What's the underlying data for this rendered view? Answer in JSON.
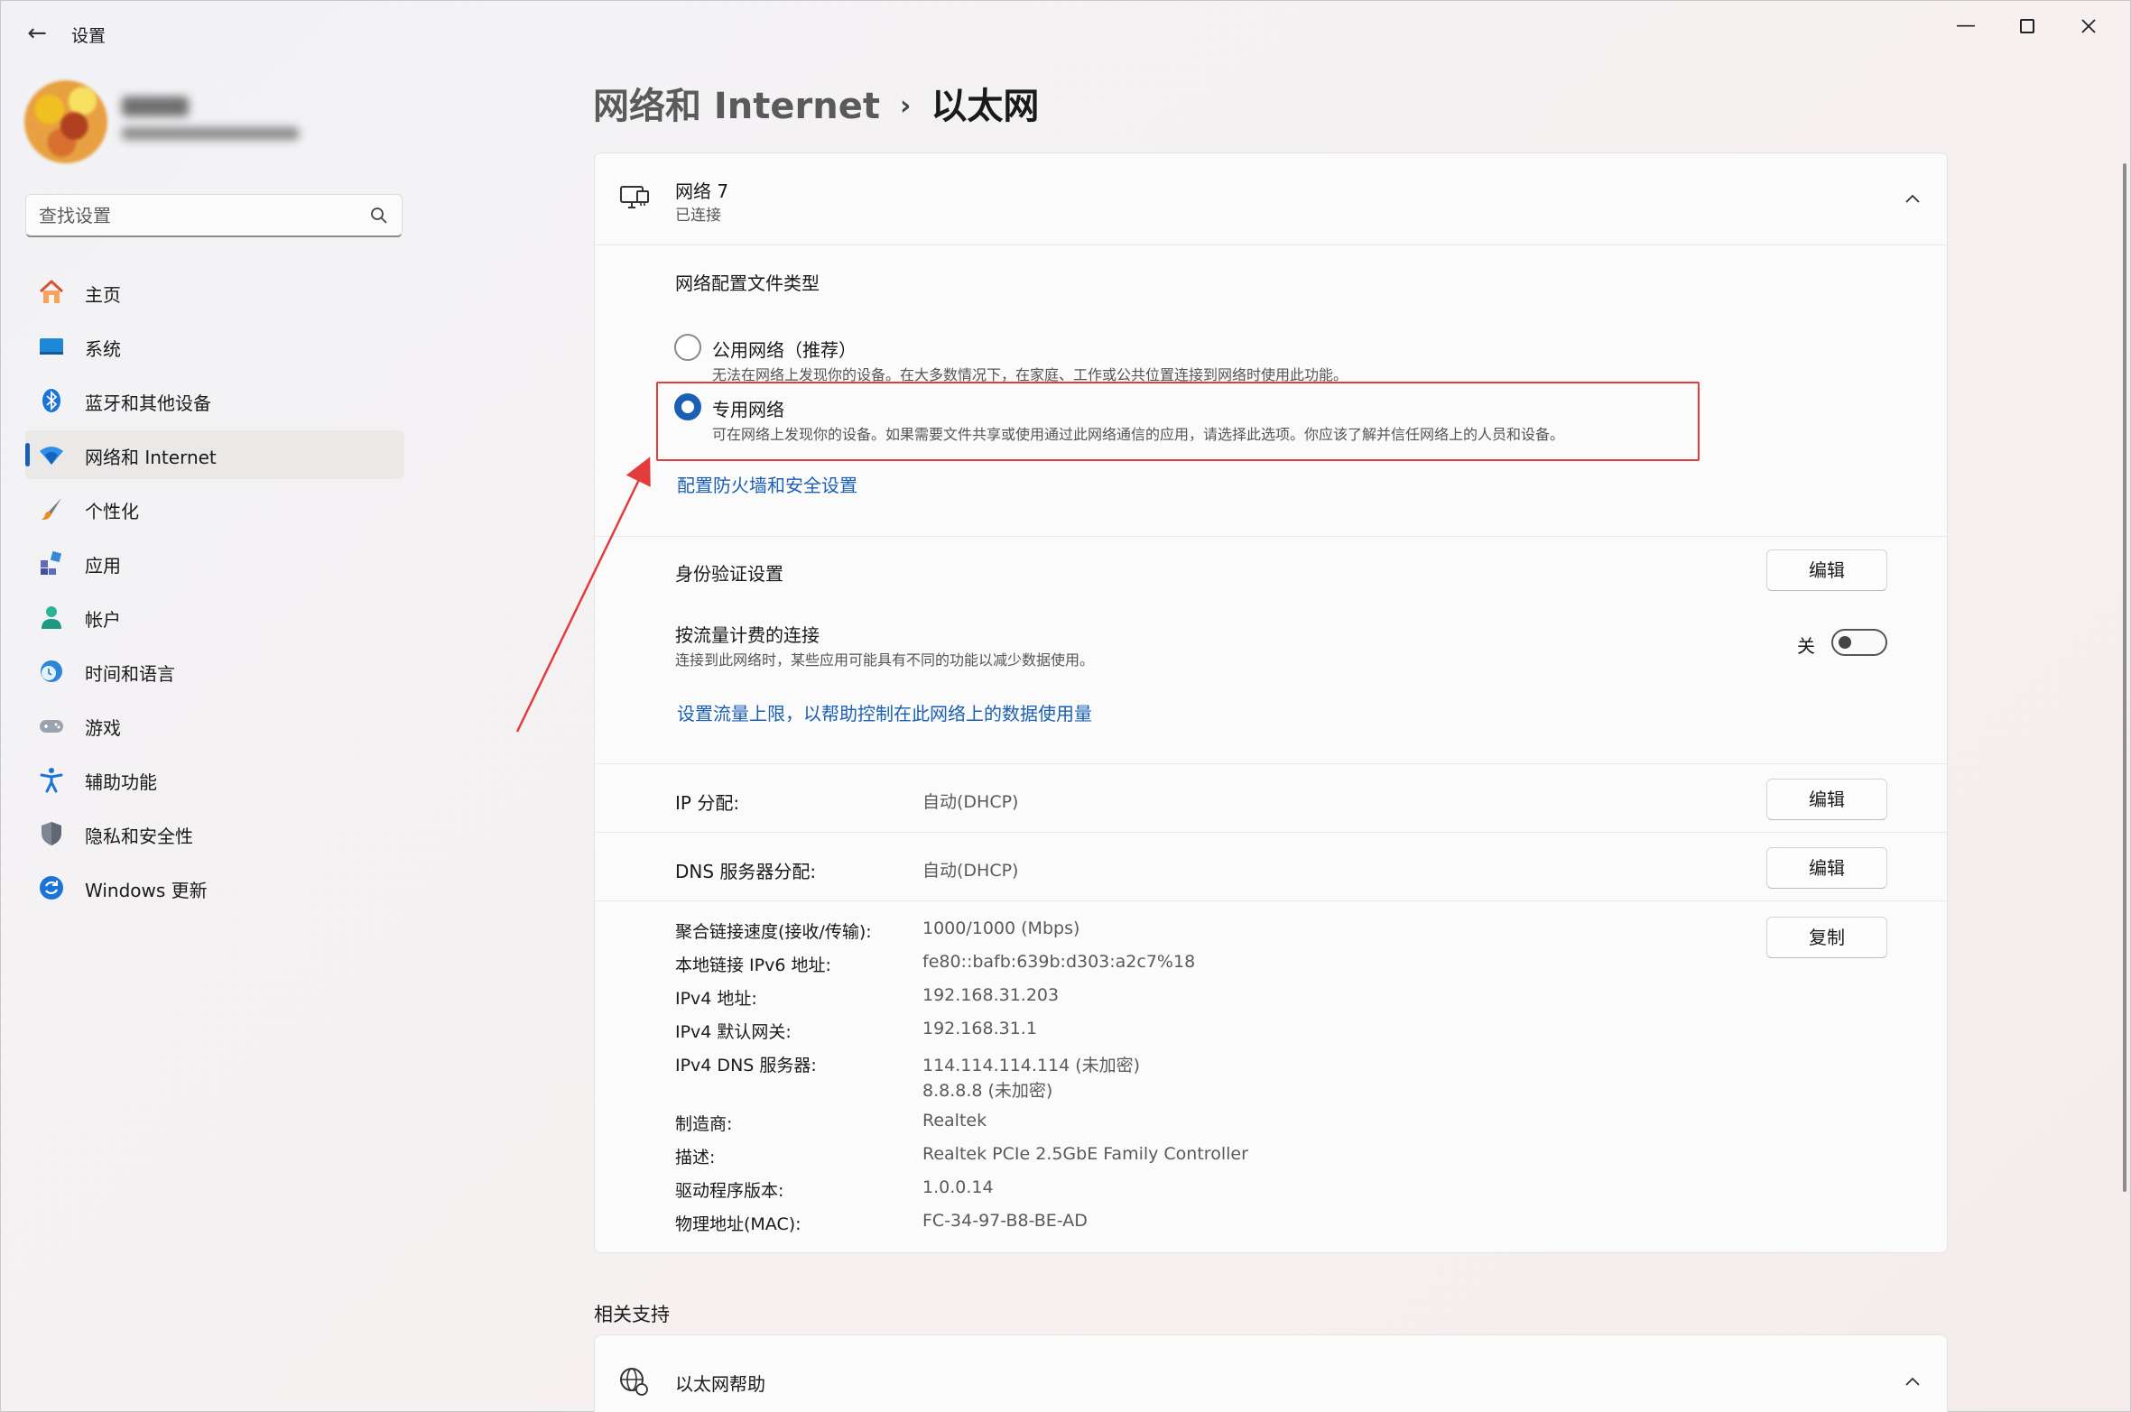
{
  "window": {
    "app_title": "设置",
    "back_symbol": "←",
    "minimize_symbol": "—"
  },
  "sidebar": {
    "search_placeholder": "查找设置",
    "items": [
      {
        "label": "主页",
        "icon": "home-icon"
      },
      {
        "label": "系统",
        "icon": "system-icon"
      },
      {
        "label": "蓝牙和其他设备",
        "icon": "bluetooth-icon"
      },
      {
        "label": "网络和 Internet",
        "icon": "wifi-icon",
        "active": true
      },
      {
        "label": "个性化",
        "icon": "brush-icon"
      },
      {
        "label": "应用",
        "icon": "apps-icon"
      },
      {
        "label": "帐户",
        "icon": "account-icon"
      },
      {
        "label": "时间和语言",
        "icon": "clock-globe-icon"
      },
      {
        "label": "游戏",
        "icon": "gamepad-icon"
      },
      {
        "label": "辅助功能",
        "icon": "accessibility-icon"
      },
      {
        "label": "隐私和安全性",
        "icon": "shield-icon"
      },
      {
        "label": "Windows 更新",
        "icon": "update-icon"
      }
    ]
  },
  "breadcrumb": {
    "parent": "网络和 Internet",
    "separator": "›",
    "current": "以太网"
  },
  "network": {
    "name": "网络 7",
    "status": "已连接",
    "profile_section_title": "网络配置文件类型",
    "public": {
      "label": "公用网络（推荐）",
      "desc": "无法在网络上发现你的设备。在大多数情况下，在家庭、工作或公共位置连接到网络时使用此功能。",
      "selected": false
    },
    "private": {
      "label": "专用网络",
      "desc": "可在网络上发现你的设备。如果需要文件共享或使用通过此网络通信的应用，请选择此选项。你应该了解并信任网络上的人员和设备。",
      "selected": true
    },
    "firewall_link": "配置防火墙和安全设置",
    "auth_label": "身份验证设置",
    "edit_label": "编辑",
    "metered_label": "按流量计费的连接",
    "metered_desc": "连接到此网络时，某些应用可能具有不同的功能以减少数据使用。",
    "metered_state": "关",
    "data_limit_link": "设置流量上限，以帮助控制在此网络上的数据使用量",
    "ip_label": "IP 分配:",
    "ip_value": "自动(DHCP)",
    "dns_label": "DNS 服务器分配:",
    "dns_value": "自动(DHCP)",
    "copy_label": "复制",
    "properties": [
      {
        "label": "聚合链接速度(接收/传输):",
        "value": "1000/1000 (Mbps)"
      },
      {
        "label": "本地链接 IPv6 地址:",
        "value": "fe80::bafb:639b:d303:a2c7%18"
      },
      {
        "label": "IPv4 地址:",
        "value": "192.168.31.203"
      },
      {
        "label": "IPv4 默认网关:",
        "value": "192.168.31.1"
      },
      {
        "label": "IPv4 DNS 服务器:",
        "value": "114.114.114.114 (未加密)",
        "value2": "8.8.8.8 (未加密)"
      },
      {
        "label": "制造商:",
        "value": "Realtek"
      },
      {
        "label": "描述:",
        "value": "Realtek PCIe 2.5GbE Family Controller"
      },
      {
        "label": "驱动程序版本:",
        "value": "1.0.0.14"
      },
      {
        "label": "物理地址(MAC):",
        "value": "FC-34-97-B8-BE-AD"
      }
    ]
  },
  "related": {
    "title": "相关支持",
    "help_label": "以太网帮助"
  },
  "colors": {
    "accent": "#1b5fb5",
    "highlight": "#e23c3c"
  }
}
